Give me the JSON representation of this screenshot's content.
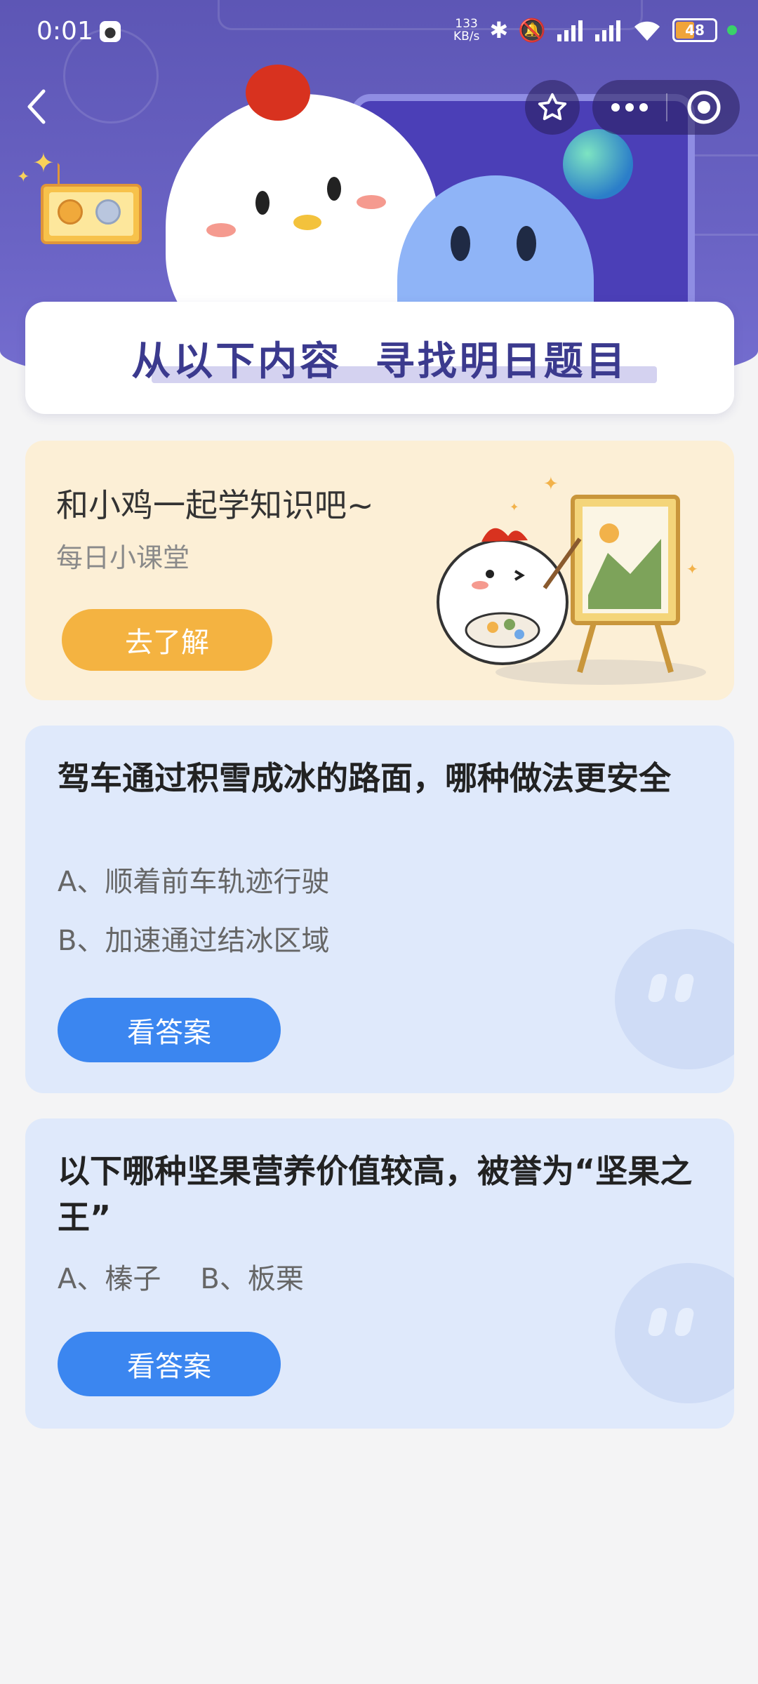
{
  "status_bar": {
    "time": "0:01",
    "net_speed_value": "133",
    "net_speed_unit": "KB/s",
    "battery": "48",
    "battery_level_percent": 48
  },
  "nav": {
    "back_icon": "chevron-left-icon",
    "favorite_icon": "star-outline-icon",
    "more_icon": "more-dots-icon",
    "close_icon": "target-circle-icon"
  },
  "hero": {
    "title": "从以下内容  寻找明日题目"
  },
  "promo": {
    "title": "和小鸡一起学知识吧~",
    "subtitle": "每日小课堂",
    "button": "去了解"
  },
  "questions": [
    {
      "title": "驾车通过积雪成冰的路面，哪种做法更安全",
      "options": [
        "A、顺着前车轨迹行驶",
        "B、加速通过结冰区域"
      ],
      "button": "看答案"
    },
    {
      "title": "以下哪种坚果营养价值较高，被誉为“坚果之王”",
      "options": [
        "A、榛子",
        "B、板栗"
      ],
      "button": "看答案"
    }
  ],
  "colors": {
    "hero_bg": "#5d56b5",
    "promo_bg": "#fcefd6",
    "promo_button": "#f4b341",
    "question_bg": "#dfe9fb",
    "answer_button": "#3b86f0"
  }
}
